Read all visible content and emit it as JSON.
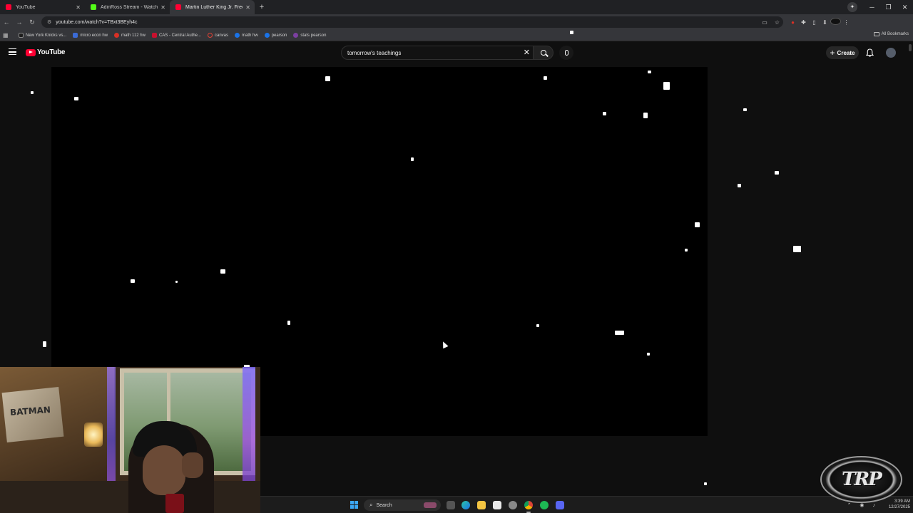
{
  "browser": {
    "tabs": [
      {
        "title": "YouTube",
        "favicon": "youtube-icon",
        "active": false
      },
      {
        "title": "AdinRoss Stream - Watch Live o",
        "favicon": "kick-icon",
        "active": false
      },
      {
        "title": "Martin Luther King Jr. Frees Th",
        "favicon": "youtube-icon",
        "active": true
      }
    ],
    "new_tab_label": "+",
    "url": "youtube.com/watch?v=TBxt3BEyh4c",
    "bookmarks": [
      {
        "label": "New York Knicks vs...",
        "color": "#1d1d1d"
      },
      {
        "label": "micro econ hw",
        "color": "#3b6bd6"
      },
      {
        "label": "math 112 hw",
        "color": "#d93025"
      },
      {
        "label": "CAS - Central Authe...",
        "color": "#c8102e"
      },
      {
        "label": "canvas",
        "color": "#e34234"
      },
      {
        "label": "math hw",
        "color": "#1a73e8"
      },
      {
        "label": "pearson",
        "color": "#1a73e8"
      },
      {
        "label": "stats pearson",
        "color": "#7b3fa0"
      }
    ],
    "all_bookmarks_label": "All Bookmarks"
  },
  "youtube": {
    "logo_text": "YouTube",
    "search_value": "tomorrow's teachings",
    "create_label": "Create",
    "accent_color": "#ff0033"
  },
  "webcam": {
    "poster_text": "BATMAN"
  },
  "taskbar": {
    "search_label": "Search",
    "time": "3:39 AM",
    "date": "12/27/2025"
  },
  "overlay": {
    "logo_text": "TRP"
  }
}
